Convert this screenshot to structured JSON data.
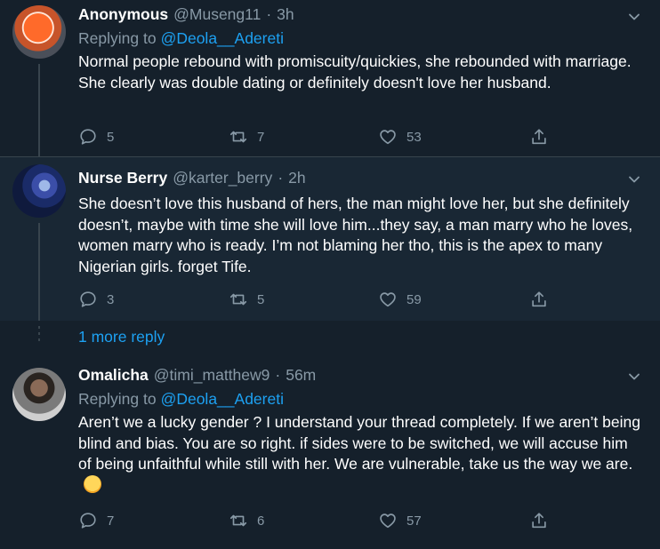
{
  "tweets": [
    {
      "name": "Anonymous",
      "handle": "@Museng11",
      "time": "3h",
      "replying_label": "Replying to",
      "replying_to": "@Deola__Adereti",
      "text": "Normal people rebound with promiscuity/quickies, she rebounded with marriage. She clearly was double dating or definitely doesn't love her husband.",
      "replies": "5",
      "retweets": "7",
      "likes": "53"
    },
    {
      "name": "Nurse Berry",
      "handle": "@karter_berry",
      "time": "2h",
      "text": "She doesn’t love this husband of hers, the man might love her, but she definitely doesn’t, maybe with time she will love him...they say, a man marry who he loves, women marry who is ready. I’m not blaming her tho, this is the apex to many Nigerian girls. forget Tife.",
      "replies": "3",
      "retweets": "5",
      "likes": "59"
    },
    {
      "name": "Omalicha",
      "handle": "@timi_matthew9",
      "time": "56m",
      "replying_label": "Replying to",
      "replying_to": "@Deola__Adereti",
      "text": "Aren’t we a lucky gender ? I understand your thread completely. If we aren’t being blind and bias. You are so right. if sides were to be switched, we will accuse him of being unfaithful while still with her. We are vulnerable, take us the way we are.",
      "emoji": "relieved-face-emoji",
      "replies": "7",
      "retweets": "6",
      "likes": "57"
    }
  ],
  "more_replies": "1 more reply",
  "colors": {
    "background": "#15202b",
    "highlight_background": "#192734",
    "secondary_text": "#8899a6",
    "accent": "#1da1f2",
    "border": "#38444d"
  },
  "icons": [
    "reply-icon",
    "retweet-icon",
    "like-icon",
    "share-icon",
    "chevron-down-icon"
  ]
}
